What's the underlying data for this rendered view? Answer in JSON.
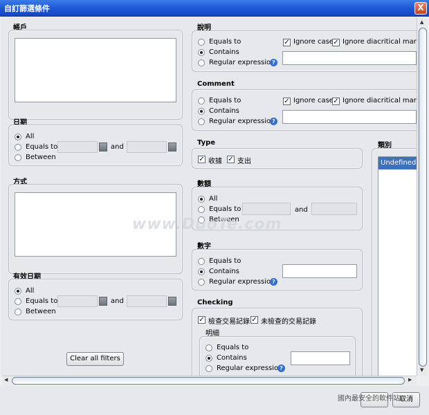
{
  "window": {
    "title": "自訂篩選條件",
    "close_label": "X"
  },
  "account": {
    "header": "帳戶"
  },
  "date": {
    "header": "日期",
    "all": "All",
    "equals": "Equals to",
    "between": "Between",
    "and": "and"
  },
  "method": {
    "header": "方式"
  },
  "valid_date": {
    "header": "有效日期",
    "all": "All",
    "equals": "Equals to",
    "between": "Between",
    "and": "and"
  },
  "clear_button": "Clear all filters",
  "description": {
    "header": "說明",
    "equals": "Equals to",
    "contains": "Contains",
    "regex": "Regular expression",
    "ignore_case": "Ignore case",
    "ignore_diacritical": "Ignore diacritical marks"
  },
  "comment": {
    "header": "Comment",
    "equals": "Equals to",
    "contains": "Contains",
    "regex": "Regular expression",
    "ignore_case": "Ignore case",
    "ignore_diacritical": "Ignore diacritical marks"
  },
  "type": {
    "header": "Type",
    "income": "收據",
    "expense": "支出"
  },
  "amount": {
    "header": "數額",
    "all": "All",
    "equals": "Equals to",
    "between": "Between",
    "and": "and"
  },
  "number": {
    "header": "數字",
    "equals": "Equals to",
    "contains": "Contains",
    "regex": "Regular expression"
  },
  "checking": {
    "header": "Checking",
    "checked": "檢查交易記錄",
    "unchecked": "未檢查的交易記錄",
    "detail_header": "明細",
    "equals": "Equals to",
    "contains": "Contains",
    "regex": "Regular expression"
  },
  "category": {
    "header": "類別",
    "items": [
      "Undefined"
    ]
  },
  "footer": {
    "cancel": "取消",
    "watermark": "www.DuoTe.com",
    "site_text": "國內最安全的軟件站"
  },
  "colors": {
    "title_bar": "#1c56d6",
    "selected": "#3f70b8"
  }
}
